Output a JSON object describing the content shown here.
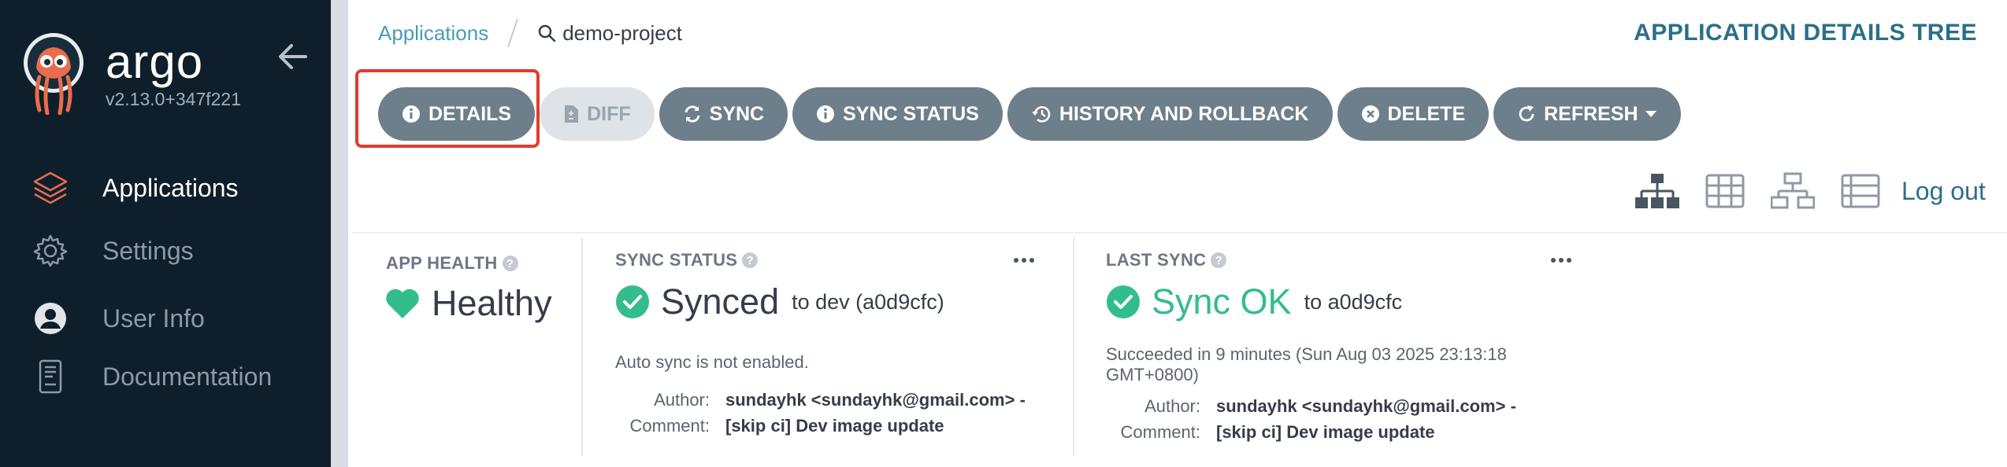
{
  "sidebar": {
    "brand": "argo",
    "version": "v2.13.0+347f221",
    "items": [
      {
        "label": "Applications",
        "icon": "layers-icon",
        "active": true
      },
      {
        "label": "Settings",
        "icon": "gear-icon",
        "active": false
      },
      {
        "label": "User Info",
        "icon": "user-icon",
        "active": false
      },
      {
        "label": "Documentation",
        "icon": "book-icon",
        "active": false
      }
    ]
  },
  "breadcrumb": {
    "root": "Applications",
    "current": "demo-project"
  },
  "page_title": "APPLICATION DETAILS TREE",
  "toolbar": {
    "details": "DETAILS",
    "diff": "DIFF",
    "sync": "SYNC",
    "sync_status": "SYNC STATUS",
    "history": "HISTORY AND ROLLBACK",
    "delete": "DELETE",
    "refresh": "REFRESH"
  },
  "view": {
    "logout": "Log out",
    "icons": [
      "tree-view-icon",
      "pods-grid-icon",
      "network-view-icon",
      "list-view-icon"
    ]
  },
  "app_health": {
    "title": "APP HEALTH",
    "status": "Healthy",
    "help": "?"
  },
  "sync_status": {
    "title": "SYNC STATUS",
    "status": "Synced",
    "target": "to dev (a0d9cfc)",
    "note": "Auto sync is not enabled.",
    "author_label": "Author:",
    "author": "sundayhk <sundayhk@gmail.com> -",
    "comment_label": "Comment:",
    "comment": "[skip ci] Dev image update",
    "help": "?"
  },
  "last_sync": {
    "title": "LAST SYNC",
    "status": "Sync OK",
    "target": "to a0d9cfc",
    "note_line1": "Succeeded in 9 minutes (Sun Aug 03 2025 23:13:18",
    "note_line2": "GMT+0800)",
    "author_label": "Author:",
    "author": "sundayhk <sundayhk@gmail.com> -",
    "comment_label": "Comment:",
    "comment": "[skip ci] Dev image update",
    "help": "?"
  },
  "colors": {
    "sidebar_bg": "#0e1f2b",
    "button_bg": "#6d7f8b",
    "accent": "#2c6e8a",
    "healthy": "#33bd8b",
    "highlight": "#e03c2e"
  }
}
